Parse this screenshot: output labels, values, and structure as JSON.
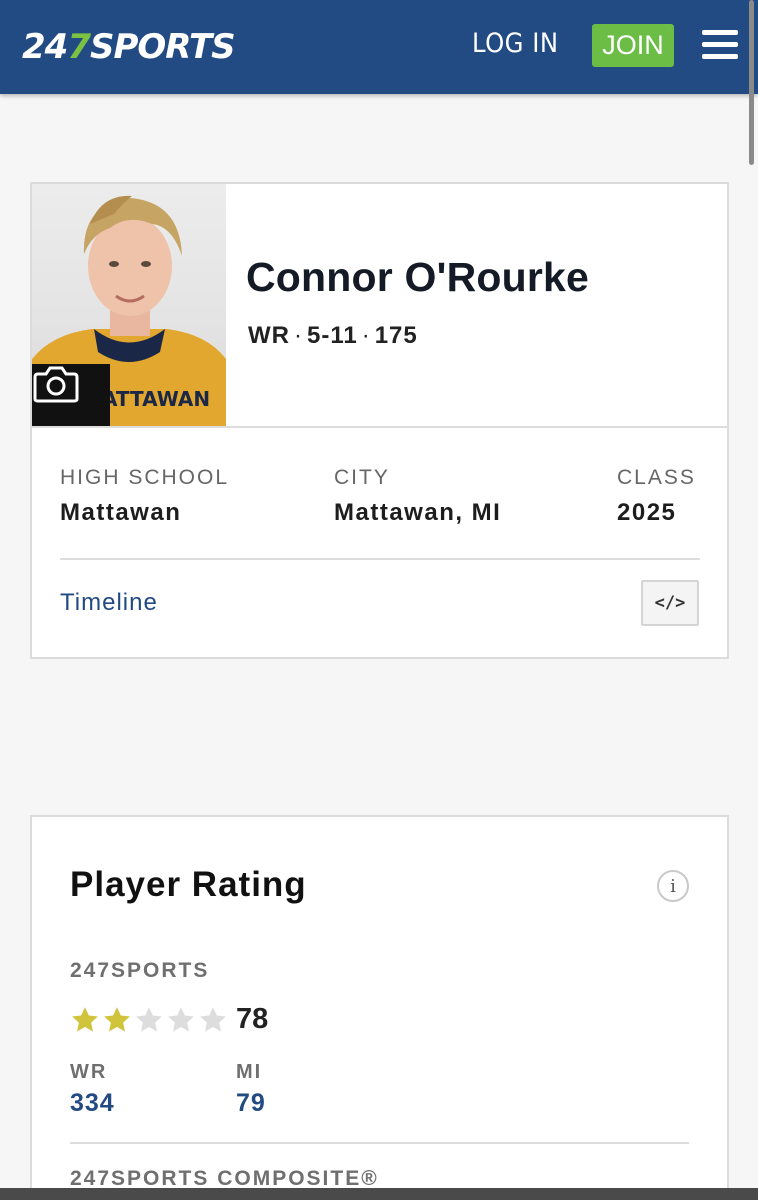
{
  "header": {
    "logo_text": "247SPORTS",
    "logo_part1": "24",
    "logo_part2": "7",
    "logo_part3": "SPORTS",
    "login_label": "LOG IN",
    "join_label": "JOIN",
    "brand_color": "#224a83",
    "accent_color": "#6cbd45",
    "menu_icon": "hamburger-menu-icon"
  },
  "player": {
    "name": "Connor O'Rourke",
    "position": "WR",
    "height": "5-11",
    "weight": "175",
    "photo_icon": "camera-icon",
    "high_school_label": "HIGH SCHOOL",
    "high_school": "Mattawan",
    "city_label": "CITY",
    "city": "Mattawan, MI",
    "class_label": "CLASS",
    "class_year": "2025",
    "timeline_label": "Timeline",
    "embed_label": "</>"
  },
  "rating": {
    "title": "Player Rating",
    "info_icon": "info-icon",
    "source_label": "247SPORTS",
    "stars_filled": 2,
    "stars_total": 5,
    "score": "78",
    "position_rank_label": "WR",
    "position_rank": "334",
    "state_rank_label": "MI",
    "state_rank": "79",
    "composite_label": "247SPORTS COMPOSITE®",
    "star_color": "#cfc43b",
    "star_empty_color": "#dddddd"
  }
}
